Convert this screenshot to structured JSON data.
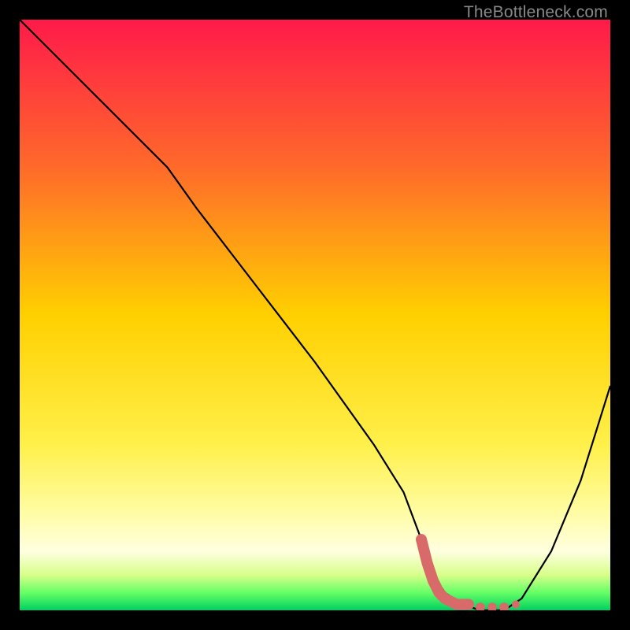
{
  "watermark": "TheBottleneck.com",
  "chart_data": {
    "type": "line",
    "title": "",
    "xlabel": "",
    "ylabel": "",
    "xlim": [
      0,
      100
    ],
    "ylim": [
      0,
      100
    ],
    "gradient_stops": [
      {
        "offset": 0,
        "color": "#ff1a4a"
      },
      {
        "offset": 25,
        "color": "#ff6a2a"
      },
      {
        "offset": 50,
        "color": "#ffd000"
      },
      {
        "offset": 72,
        "color": "#fff04a"
      },
      {
        "offset": 83,
        "color": "#fffca0"
      },
      {
        "offset": 90,
        "color": "#ffffe0"
      },
      {
        "offset": 94,
        "color": "#d8ff8a"
      },
      {
        "offset": 97,
        "color": "#66ff66"
      },
      {
        "offset": 100,
        "color": "#00d060"
      }
    ],
    "series": [
      {
        "name": "bottleneck-curve",
        "x": [
          0,
          10,
          20,
          25,
          30,
          40,
          50,
          60,
          65,
          68,
          70,
          72,
          75,
          78,
          80,
          82,
          85,
          90,
          95,
          100
        ],
        "y": [
          100,
          90,
          80,
          75,
          68,
          55,
          42,
          28,
          20,
          12,
          6,
          3,
          1,
          0,
          0,
          0,
          2,
          10,
          22,
          38
        ]
      }
    ],
    "markers": {
      "name": "highlight-region",
      "color": "#d96a6a",
      "points": [
        {
          "x": 68,
          "y": 12
        },
        {
          "x": 69,
          "y": 8
        },
        {
          "x": 70,
          "y": 5
        },
        {
          "x": 71,
          "y": 3
        },
        {
          "x": 72,
          "y": 2
        },
        {
          "x": 74,
          "y": 1
        },
        {
          "x": 76,
          "y": 1
        },
        {
          "x": 78,
          "y": 0.5
        },
        {
          "x": 80,
          "y": 0.5
        },
        {
          "x": 82,
          "y": 0.5
        },
        {
          "x": 84,
          "y": 1
        }
      ]
    }
  }
}
